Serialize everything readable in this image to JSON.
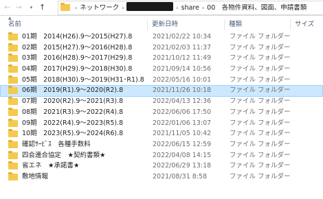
{
  "address_bar": {
    "path": [
      "ネットワーク",
      "share",
      "00　各物件資料、図面、申請書類"
    ]
  },
  "columns": {
    "name": "名前",
    "date": "更新日時",
    "type": "種類",
    "size": "サイズ"
  },
  "rows": [
    {
      "name": "01期　2014(H26).9～2015(H27).8",
      "date": "2021/02/22 10:34",
      "type": "ファイル フォルダー"
    },
    {
      "name": "02期　2015(H27).9～2016(H28).8",
      "date": "2021/02/03 11:37",
      "type": "ファイル フォルダー"
    },
    {
      "name": "03期　2016(H28).9～2017(H29).8",
      "date": "2021/10/12 11:49",
      "type": "ファイル フォルダー"
    },
    {
      "name": "04期　2017(H29).9～2018(H30).8",
      "date": "2021/09/14 10:56",
      "type": "ファイル フォルダー"
    },
    {
      "name": "05期　2018(H30).9～2019(H31･R1).8",
      "date": "2022/05/16 10:01",
      "type": "ファイル フォルダー"
    },
    {
      "name": "06期　2019(R1).9～2020(R2).8",
      "date": "2021/11/26 10:18",
      "type": "ファイル フォルダー",
      "selected": true
    },
    {
      "name": "07期　2020(R2).9～2021(R3).8",
      "date": "2022/04/13 12:36",
      "type": "ファイル フォルダー"
    },
    {
      "name": "08期　2021(R3).9～2022(R4).8",
      "date": "2022/06/06 17:50",
      "type": "ファイル フォルダー"
    },
    {
      "name": "09期　2022(R4).9～2023(R5).8",
      "date": "2022/01/06 13:07",
      "type": "ファイル フォルダー"
    },
    {
      "name": "10期　2023(R5).9～2024(R6).8",
      "date": "2021/11/05 10:42",
      "type": "ファイル フォルダー"
    },
    {
      "name": "確認ｻｰﾋﾞｽ　各種手数料",
      "date": "2022/06/15 12:59",
      "type": "ファイル フォルダー"
    },
    {
      "name": "四会連合協定　★契約書類★",
      "date": "2022/04/08 14:15",
      "type": "ファイル フォルダー"
    },
    {
      "name": "省エネ　★承諾書★",
      "date": "2022/06/29 13:18",
      "type": "ファイル フォルダー"
    },
    {
      "name": "敷地情報",
      "date": "2021/08/31 8:58",
      "type": "ファイル フォルダー"
    }
  ]
}
